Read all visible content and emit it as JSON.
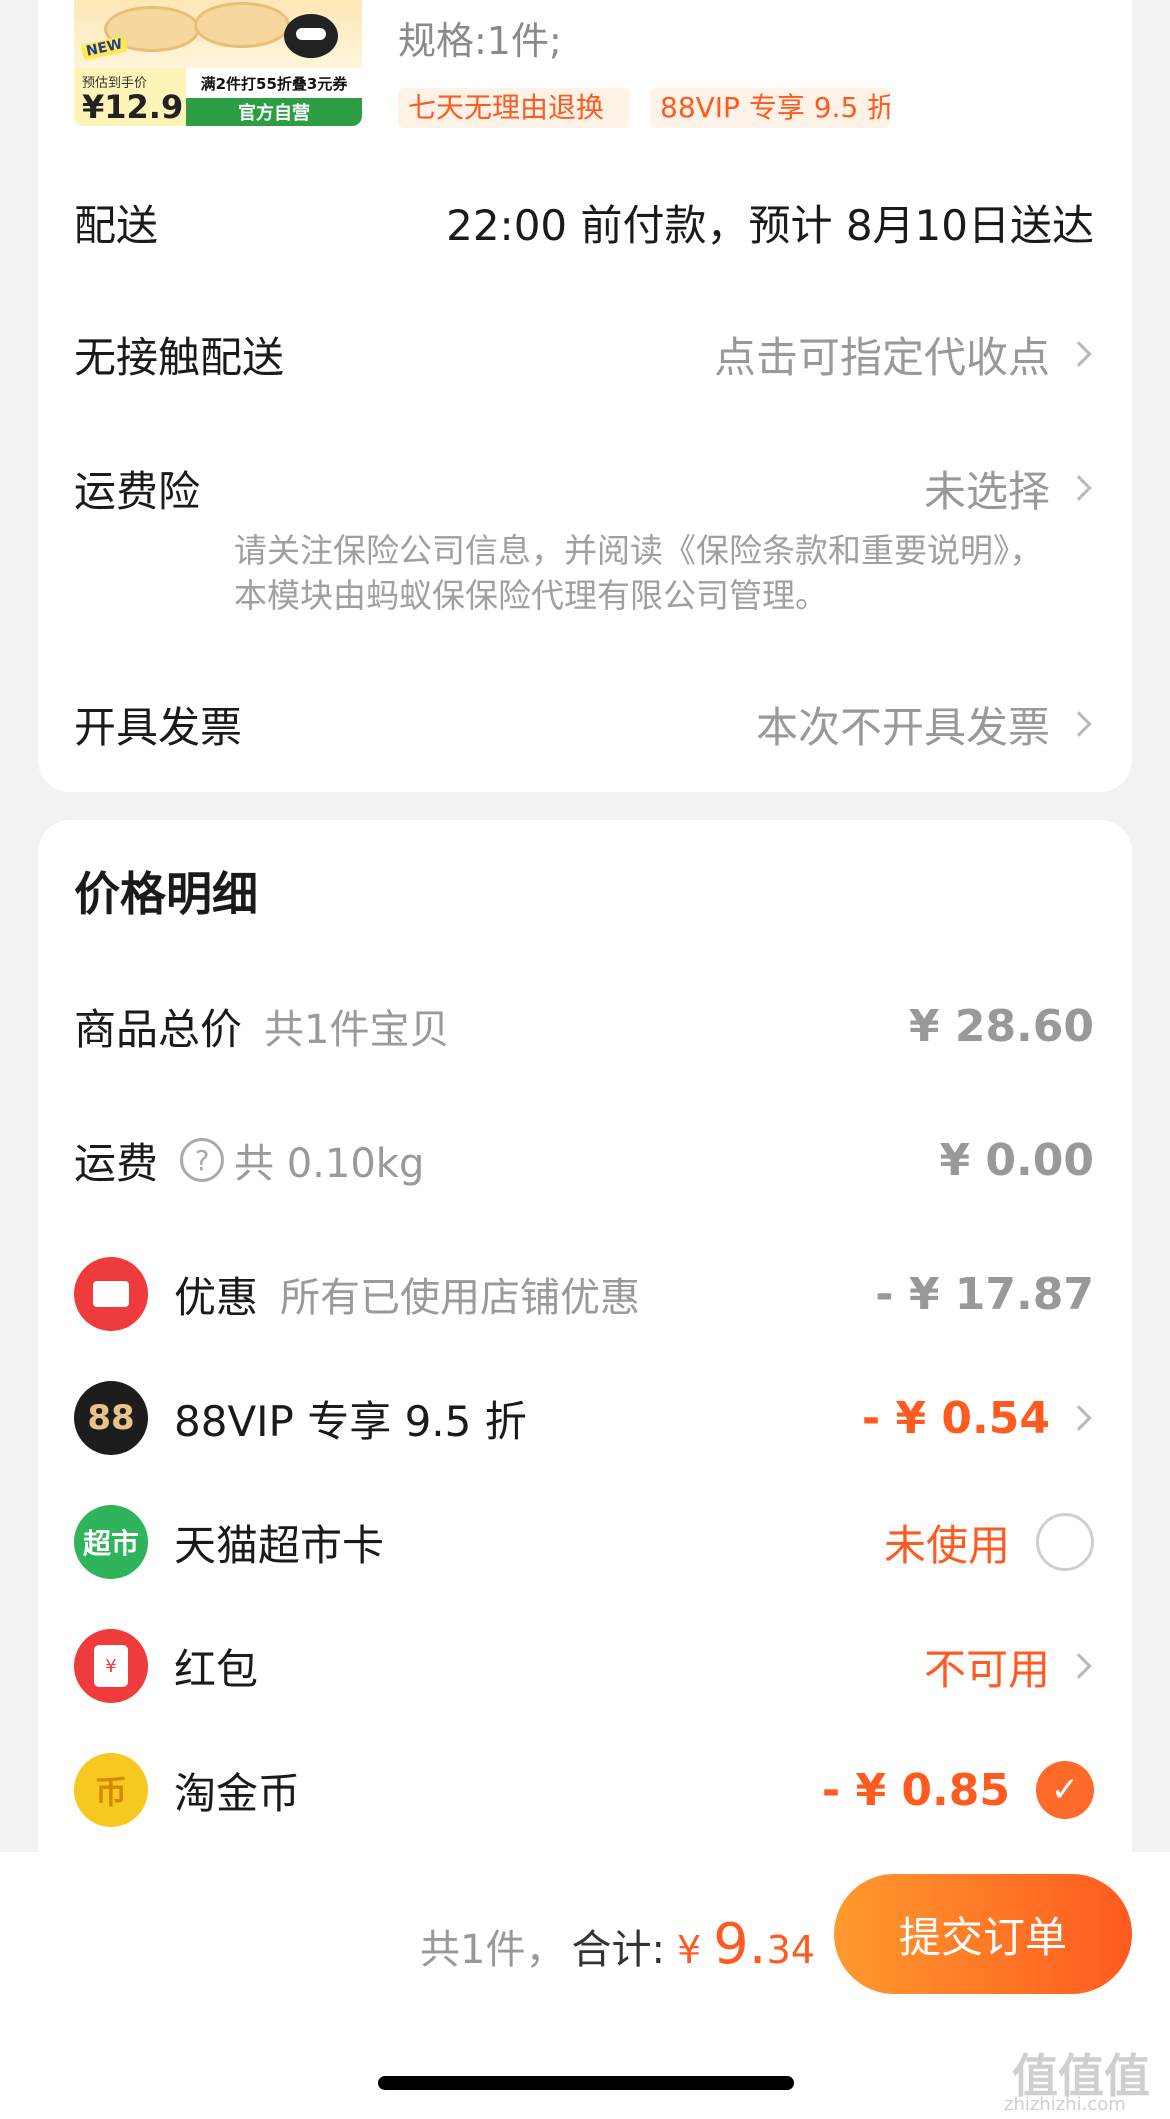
{
  "product": {
    "thumb_new": "NEW",
    "thumb_price_label": "预估到手价",
    "thumb_price": "¥12.9",
    "thumb_promo": "满2件打55折叠3元券",
    "thumb_mall": "官方自营",
    "spec": "规格:1件;",
    "tags": [
      "七天无理由退换",
      "88VIP 专享 9.5 折"
    ]
  },
  "delivery": {
    "label": "配送",
    "value": "22:00 前付款，预计 8月10日送达"
  },
  "contactless": {
    "label": "无接触配送",
    "value": "点击可指定代收点"
  },
  "insurance": {
    "label": "运费险",
    "value": "未选择",
    "note": "请关注保险公司信息，并阅读《保险条款和重要说明》，本模块由蚂蚁保保险代理有限公司管理。"
  },
  "invoice": {
    "label": "开具发票",
    "value": "本次不开具发票"
  },
  "price_detail": {
    "title": "价格明细",
    "items_total": {
      "label": "商品总价",
      "sub": "共1件宝贝",
      "value": "¥ 28.60"
    },
    "shipping": {
      "label": "运费",
      "sub": "共 0.10kg",
      "value": "¥ 0.00"
    },
    "discount": {
      "label": "优惠",
      "sub": "所有已使用店铺优惠",
      "value": "- ¥ 17.87"
    },
    "vip": {
      "icon_text": "88",
      "label": "88VIP 专享 9.5 折",
      "value": "- ¥ 0.54"
    },
    "supermarket": {
      "icon_text": "超市",
      "label": "天猫超市卡",
      "value": "未使用"
    },
    "redpacket": {
      "icon_text": "¥",
      "label": "红包",
      "value": "不可用"
    },
    "taojinbi": {
      "icon_text": "币",
      "label": "淘金币",
      "value": "- ¥ 0.85"
    }
  },
  "footer": {
    "count": "共1件，",
    "total_label": "合计:",
    "currency": "¥",
    "total_int": "9.",
    "total_dec": "34",
    "submit": "提交订单"
  },
  "watermark": {
    "main": "值值值",
    "sub": "zhizhizhi.com"
  },
  "colors": {
    "accent": "#ff5a1f",
    "button_start": "#ff9a2e",
    "button_end": "#ff5a1f"
  }
}
